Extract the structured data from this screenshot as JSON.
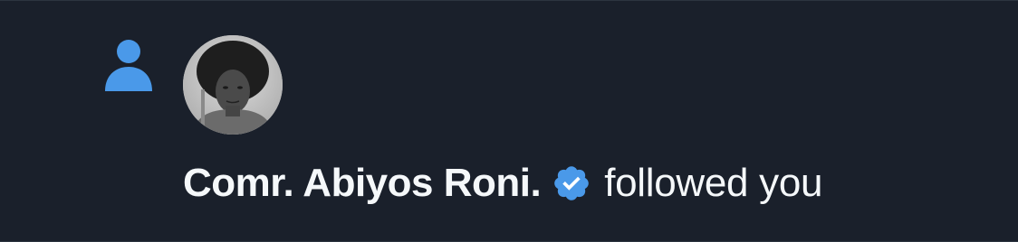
{
  "notification": {
    "icon": "person-icon",
    "icon_color": "#4a99e9",
    "avatar": "profile-photo",
    "user_name": "Comr. Abiyos Roni.",
    "verified_icon": "verified-badge-icon",
    "verified_color": "#4a99e9",
    "action_text": "followed you"
  }
}
